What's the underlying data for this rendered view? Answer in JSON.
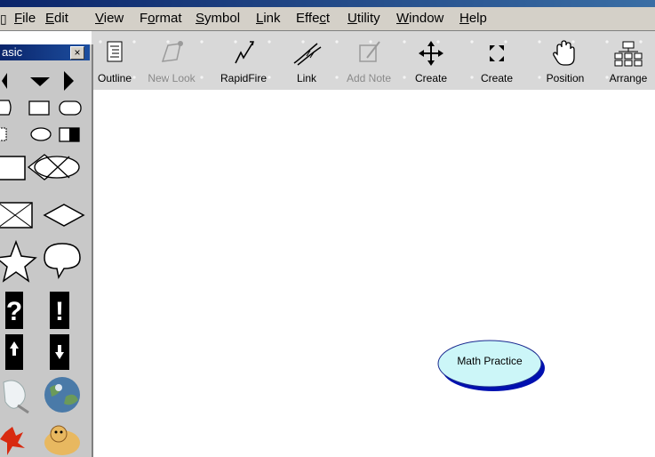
{
  "menubar": {
    "items": [
      {
        "pre": "",
        "u": "F",
        "post": "ile"
      },
      {
        "pre": "",
        "u": "E",
        "post": "dit"
      },
      {
        "pre": "",
        "u": "V",
        "post": "iew"
      },
      {
        "pre": "F",
        "u": "o",
        "post": "rmat"
      },
      {
        "pre": "",
        "u": "S",
        "post": "ymbol"
      },
      {
        "pre": "",
        "u": "L",
        "post": "ink"
      },
      {
        "pre": "Effe",
        "u": "c",
        "post": "t"
      },
      {
        "pre": "",
        "u": "U",
        "post": "tility"
      },
      {
        "pre": "",
        "u": "W",
        "post": "indow"
      },
      {
        "pre": "",
        "u": "H",
        "post": "elp"
      }
    ]
  },
  "toolbar": {
    "tools": [
      {
        "label": "Outline",
        "icon": "outline-icon",
        "enabled": true
      },
      {
        "label": "New Look",
        "icon": "new-look-icon",
        "enabled": false
      },
      {
        "label": "RapidFire",
        "icon": "rapidfire-icon",
        "enabled": true
      },
      {
        "label": "Link",
        "icon": "link-icon",
        "enabled": true
      },
      {
        "label": "Add Note",
        "icon": "add-note-icon",
        "enabled": false
      },
      {
        "label": "Create",
        "icon": "create-arrows-icon",
        "enabled": true
      },
      {
        "label": "Create",
        "icon": "create-expand-icon",
        "enabled": true
      },
      {
        "label": "Position",
        "icon": "hand-icon",
        "enabled": true
      },
      {
        "label": "Arrange",
        "icon": "arrange-icon",
        "enabled": true
      }
    ]
  },
  "palette": {
    "title": "asic",
    "close_label": "×"
  },
  "canvas": {
    "node_label": "Math Practice",
    "node_fill": "#ccf6f8",
    "node_shadow": "#0010b0"
  }
}
